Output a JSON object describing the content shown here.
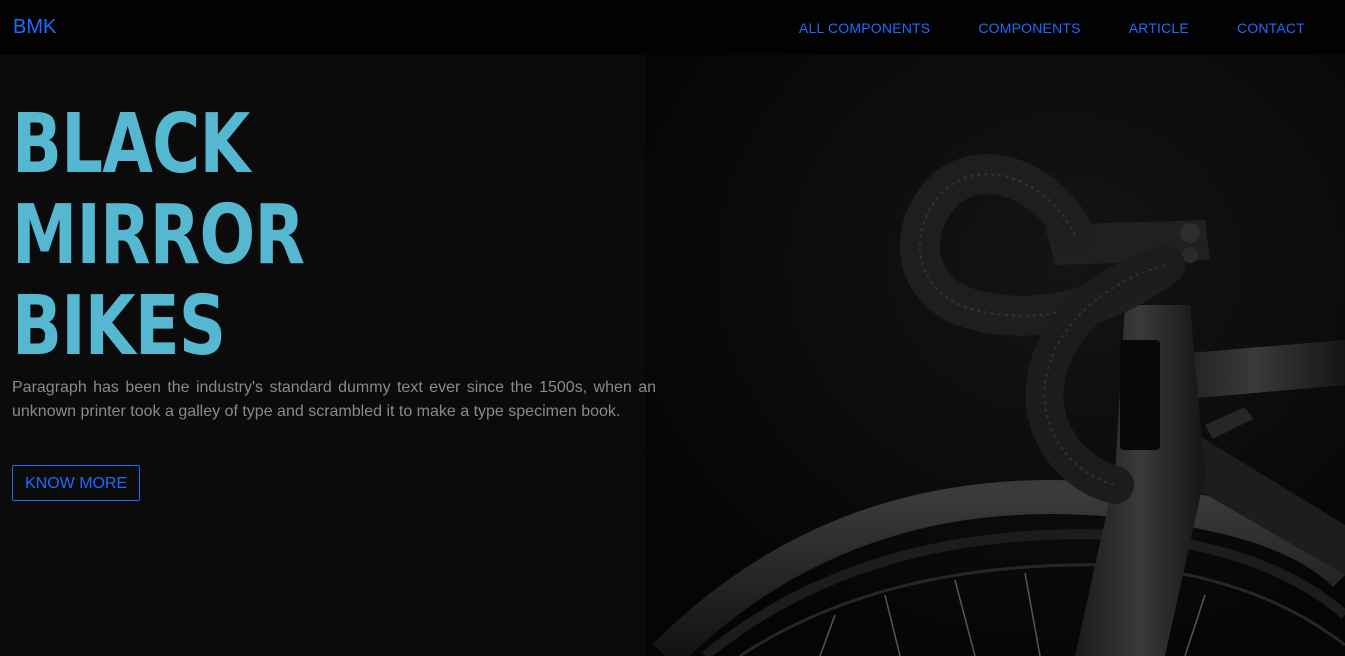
{
  "nav": {
    "brand": "BMK",
    "links": [
      {
        "label": "ALL COMPONENTS"
      },
      {
        "label": "COMPONENTS"
      },
      {
        "label": "ARTICLE"
      },
      {
        "label": "CONTACT"
      }
    ]
  },
  "hero": {
    "title_lines": [
      "BLACK",
      "MIRROR",
      "BIKES"
    ],
    "paragraph": "Paragraph has been the industry's standard dummy text ever since the 1500s, when an unknown printer took a galley of type and scrambled it to make a type specimen book.",
    "cta_label": "KNOW MORE"
  },
  "colors": {
    "accent": "#1e6cff",
    "title": "#55b7d0",
    "background": "#0b0b0b",
    "navbar": "#020202",
    "paragraph": "#8a8a8a"
  }
}
